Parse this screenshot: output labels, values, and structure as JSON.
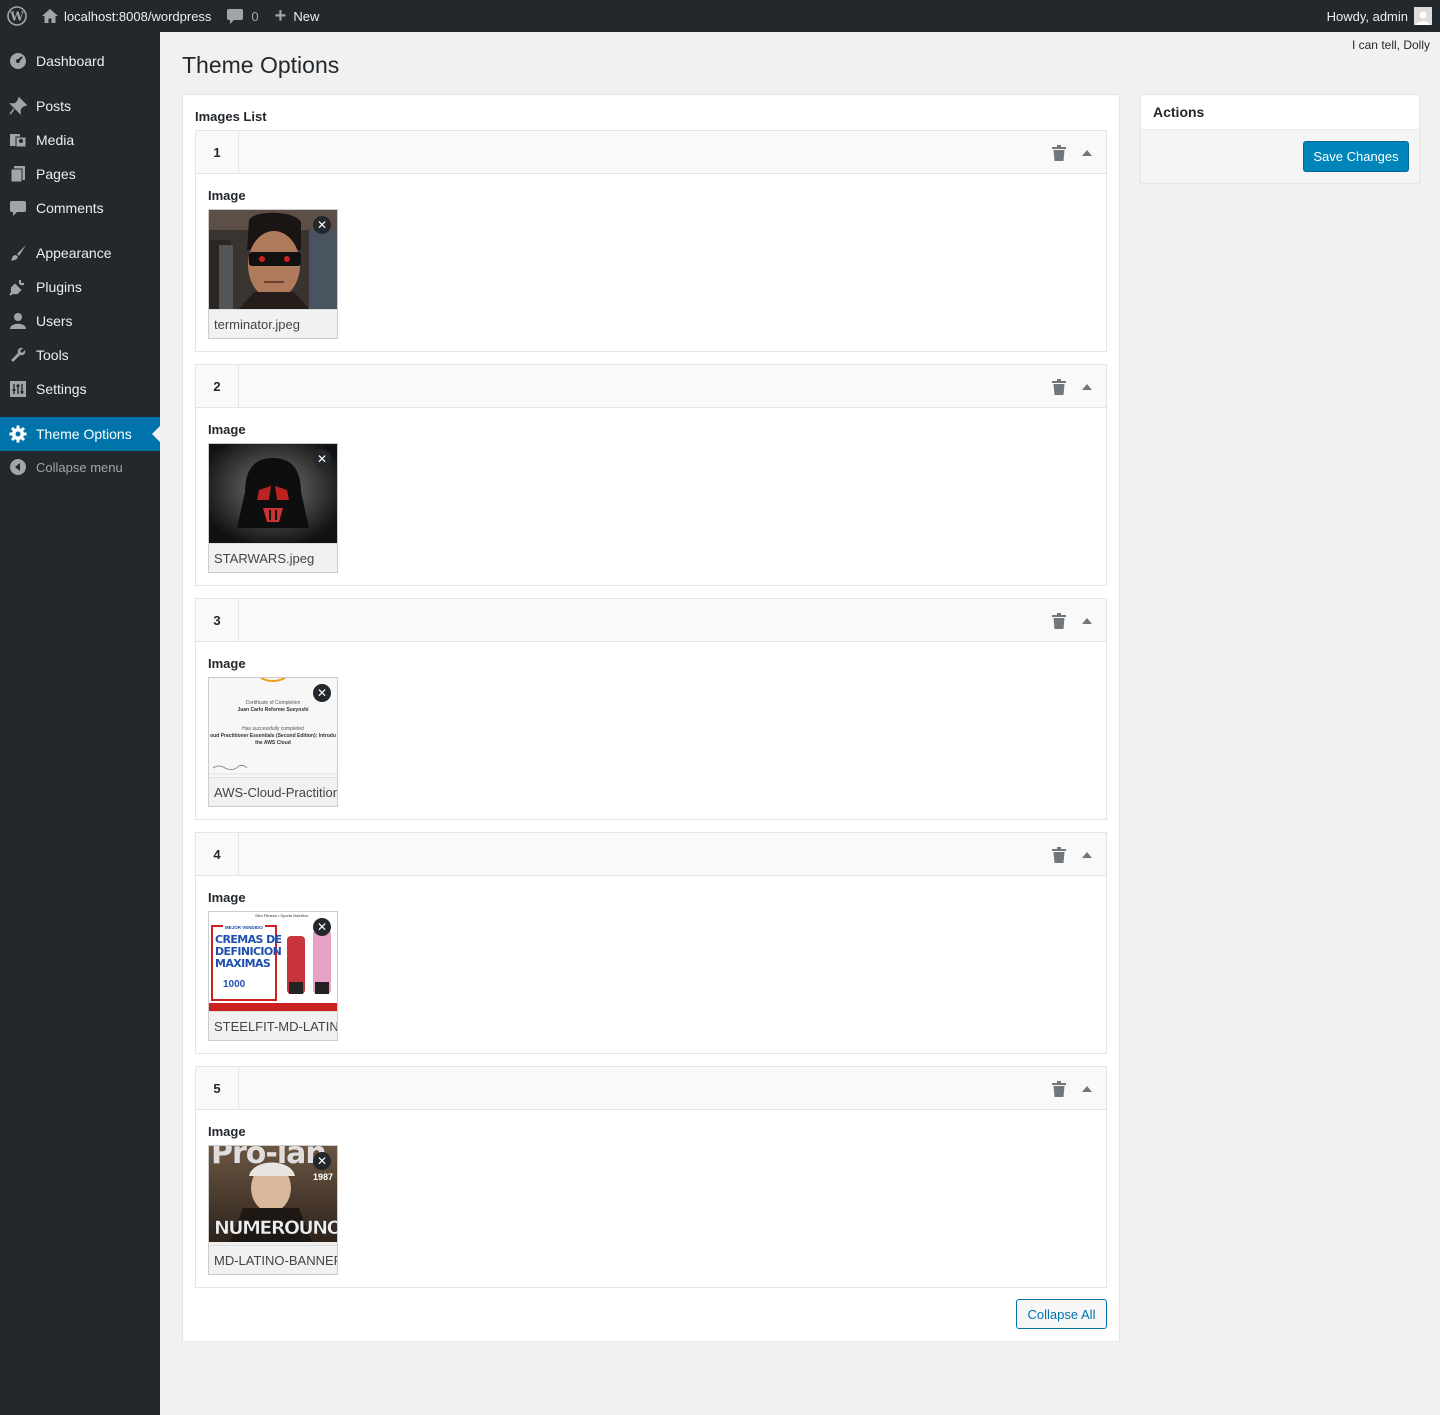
{
  "admin_bar": {
    "site_url": "localhost:8008/wordpress",
    "comments_count": "0",
    "new_label": "New",
    "greeting": "Howdy, admin"
  },
  "sidebar": {
    "items": [
      {
        "label": "Dashboard",
        "icon": "dashboard-icon"
      },
      {
        "label": "Posts",
        "icon": "pin-icon"
      },
      {
        "label": "Media",
        "icon": "media-icon"
      },
      {
        "label": "Pages",
        "icon": "pages-icon"
      },
      {
        "label": "Comments",
        "icon": "comment-icon"
      },
      {
        "label": "Appearance",
        "icon": "brush-icon"
      },
      {
        "label": "Plugins",
        "icon": "plugin-icon"
      },
      {
        "label": "Users",
        "icon": "user-icon"
      },
      {
        "label": "Tools",
        "icon": "wrench-icon"
      },
      {
        "label": "Settings",
        "icon": "settings-icon"
      },
      {
        "label": "Theme Options",
        "icon": "gear-icon",
        "current": true
      }
    ],
    "collapse_label": "Collapse menu"
  },
  "dolly": "I can tell, Dolly",
  "page": {
    "title": "Theme Options",
    "list_label": "Images List",
    "collapse_all_label": "Collapse All"
  },
  "groups": [
    {
      "number": "1",
      "field_label": "Image",
      "filename": "terminator.jpeg"
    },
    {
      "number": "2",
      "field_label": "Image",
      "filename": "STARWARS.jpeg"
    },
    {
      "number": "3",
      "field_label": "Image",
      "filename": "AWS-Cloud-Practitioner-Essentials-Certificate.png"
    },
    {
      "number": "4",
      "field_label": "Image",
      "filename": "STEELFIT-MD-LATINO-Banner.jpg"
    },
    {
      "number": "5",
      "field_label": "Image",
      "filename": "MD-LATINO-BANNER-NUMERO-UNO.jpg"
    }
  ],
  "thumb_text": {
    "aws_line1": "Certificate of Completion",
    "aws_line2": "Juan Carlo Reforme Sueyoshi",
    "aws_line3": "Has successfully completed",
    "aws_line4": "oud Practitioner Essentials (Second Edition): Introdu",
    "aws_line5": "the AWS Cloud",
    "steel_header": "Slim Fitness • Sports Nutrition",
    "steel_badge": "MEJOR VENDIDO",
    "steel_line1": "CREMAS DE",
    "steel_line2": "DEFINICION",
    "steel_line3": "MAXIMAS",
    "steel_count": "1000",
    "md_top": "Pro-lan",
    "md_year": "1987",
    "md_main": "NUMEROUNO"
  },
  "actions": {
    "title": "Actions",
    "save_label": "Save Changes"
  },
  "colors": {
    "admin_dark": "#23282d",
    "accent": "#0073aa",
    "primary_button": "#0085ba",
    "background": "#f1f1f1"
  }
}
